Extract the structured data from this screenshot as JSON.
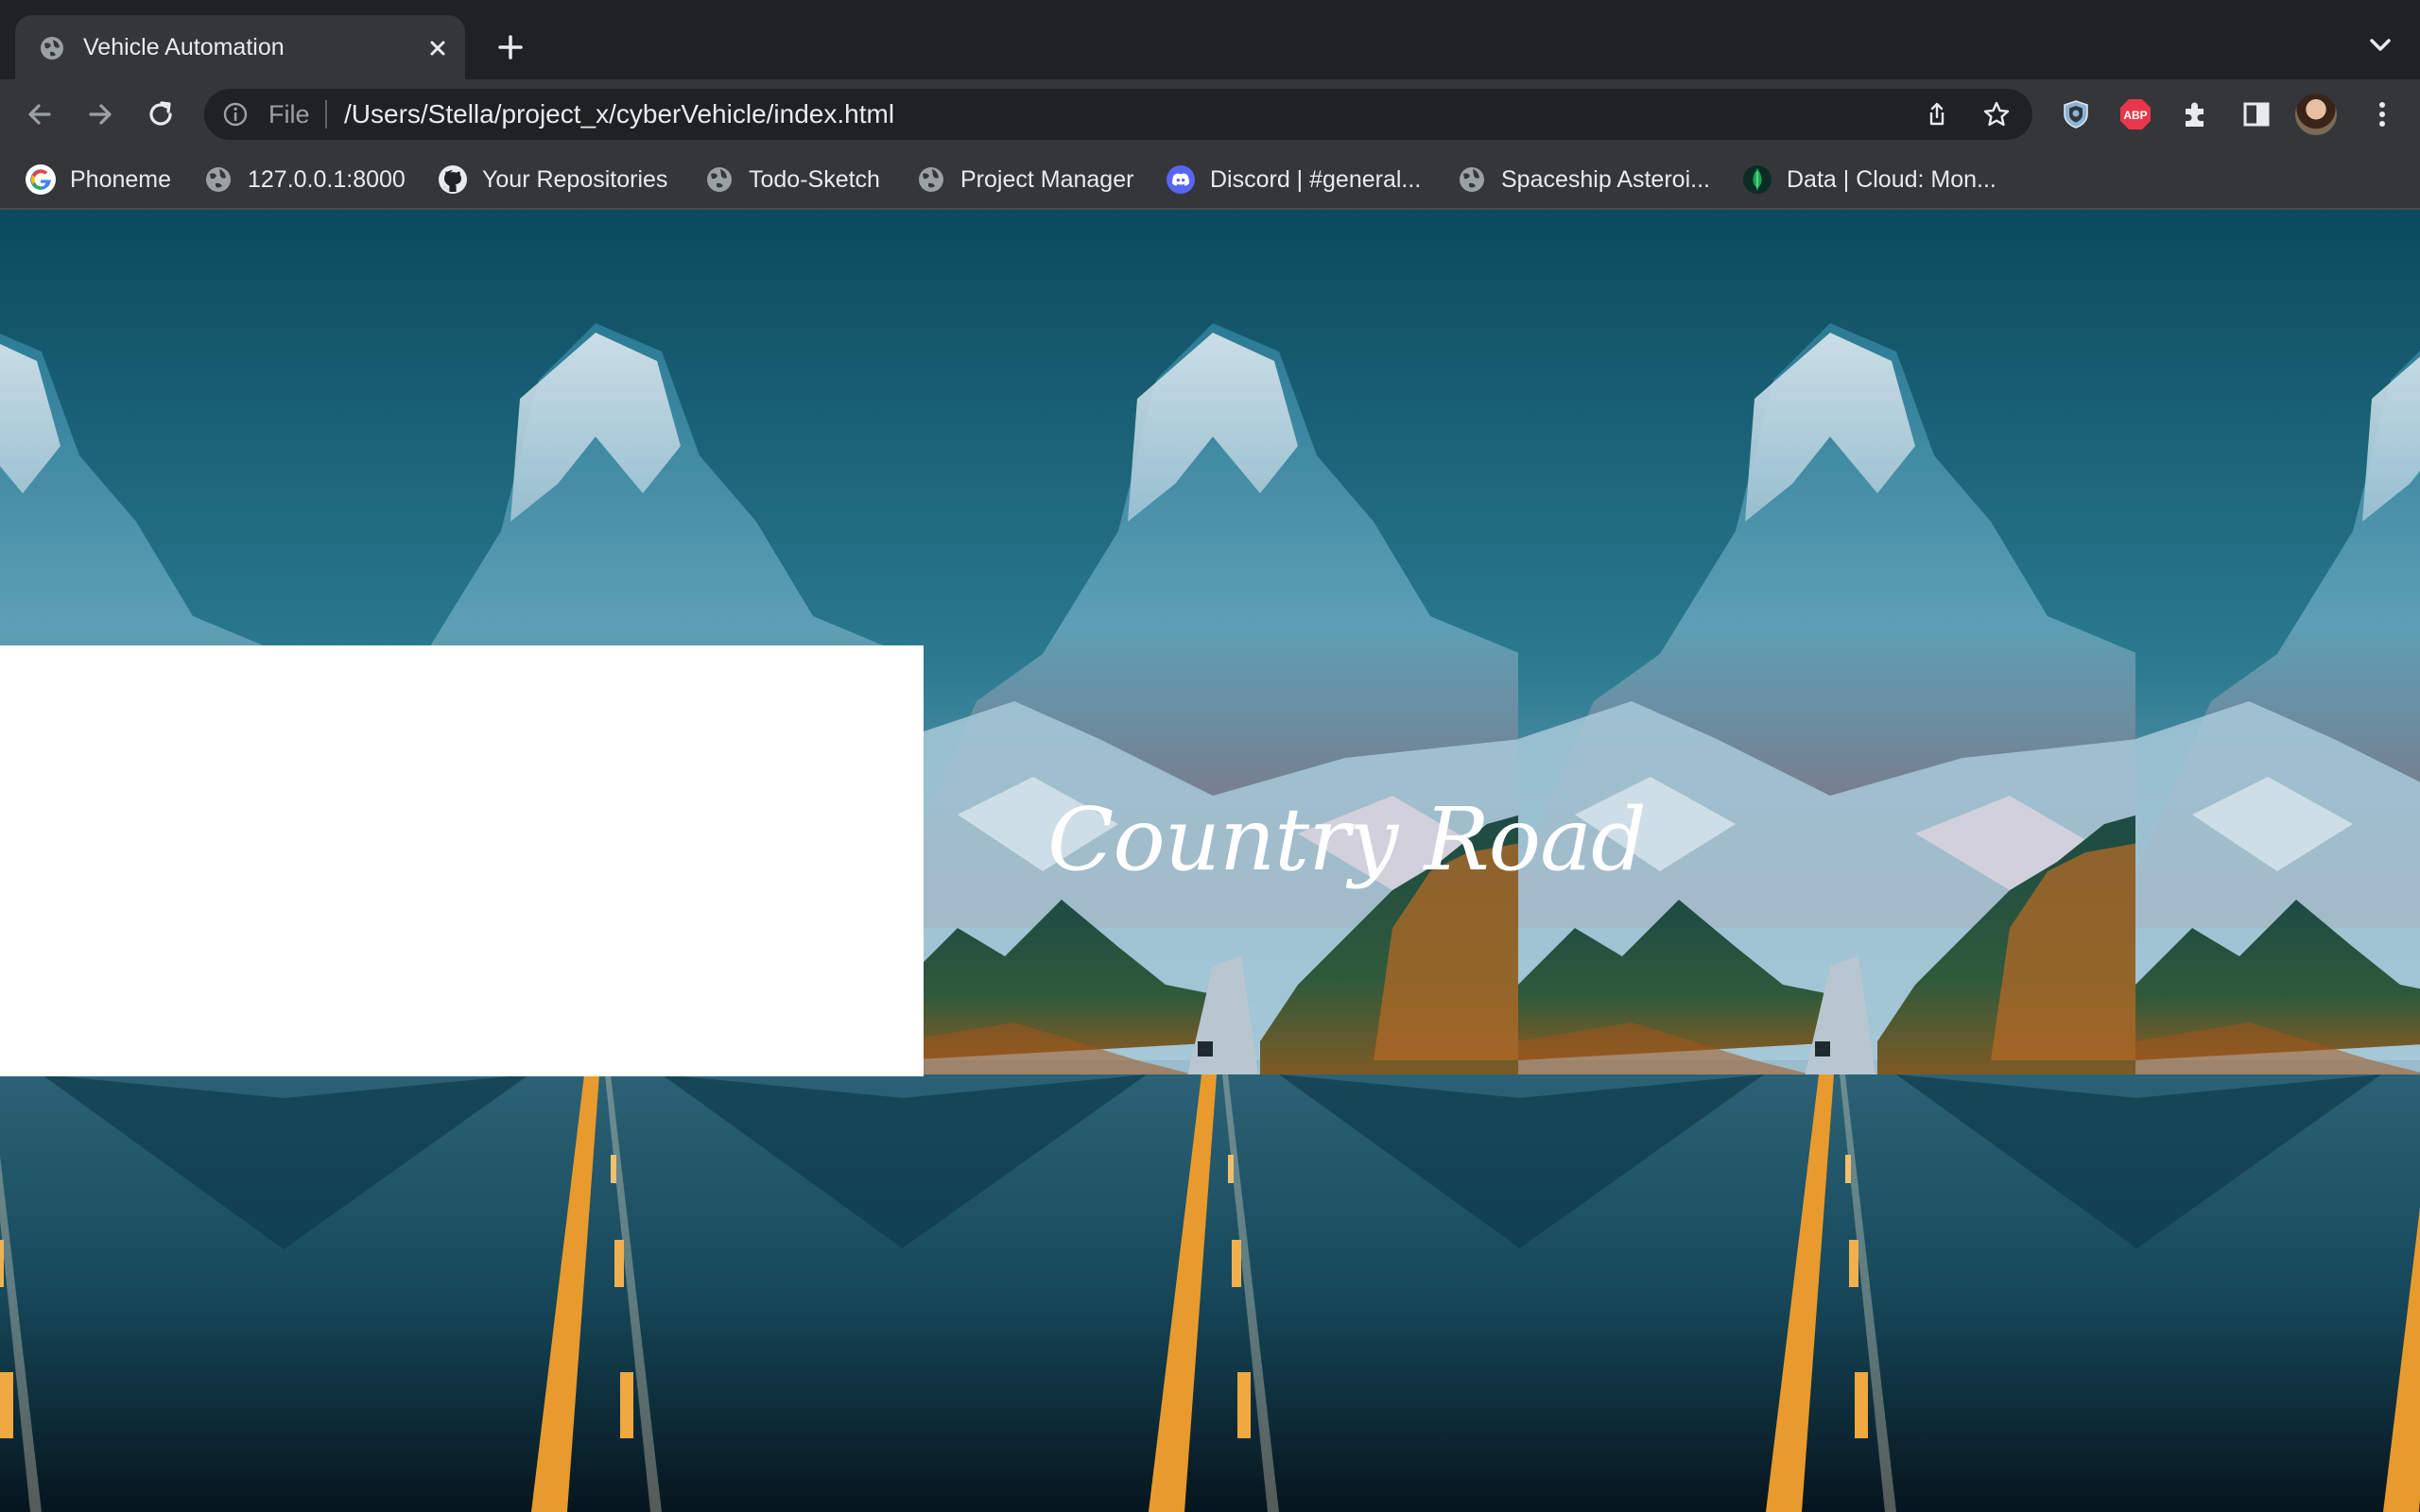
{
  "tab": {
    "title": "Vehicle Automation",
    "favicon": "globe-icon"
  },
  "omnibox": {
    "scheme_label": "File",
    "url": "/Users/Stella/project_x/cyberVehicle/index.html"
  },
  "bookmarks": [
    {
      "label": "Phoneme",
      "icon": "google-icon"
    },
    {
      "label": "127.0.0.1:8000",
      "icon": "globe-icon"
    },
    {
      "label": "Your Repositories",
      "icon": "github-icon"
    },
    {
      "label": "Todo-Sketch",
      "icon": "globe-icon"
    },
    {
      "label": "Project Manager",
      "icon": "globe-icon"
    },
    {
      "label": "Discord | #general...",
      "icon": "discord-icon"
    },
    {
      "label": "Spaceship Asteroi...",
      "icon": "globe-icon"
    },
    {
      "label": "Data | Cloud: Mon...",
      "icon": "mongodb-leaf-icon"
    }
  ],
  "extensions": [
    "shield-extension-icon",
    "adblock-plus-icon",
    "puzzle-extensions-icon",
    "side-panel-icon"
  ],
  "abp_badge": "ABP",
  "page": {
    "hero_title": "Country Road"
  },
  "colors": {
    "tab_strip": "#202124",
    "toolbar": "#35363a",
    "omnibox": "#202124",
    "abp_red": "#e8374a",
    "discord_blurple": "#5865f2",
    "mongodb_green": "#13aa52"
  }
}
